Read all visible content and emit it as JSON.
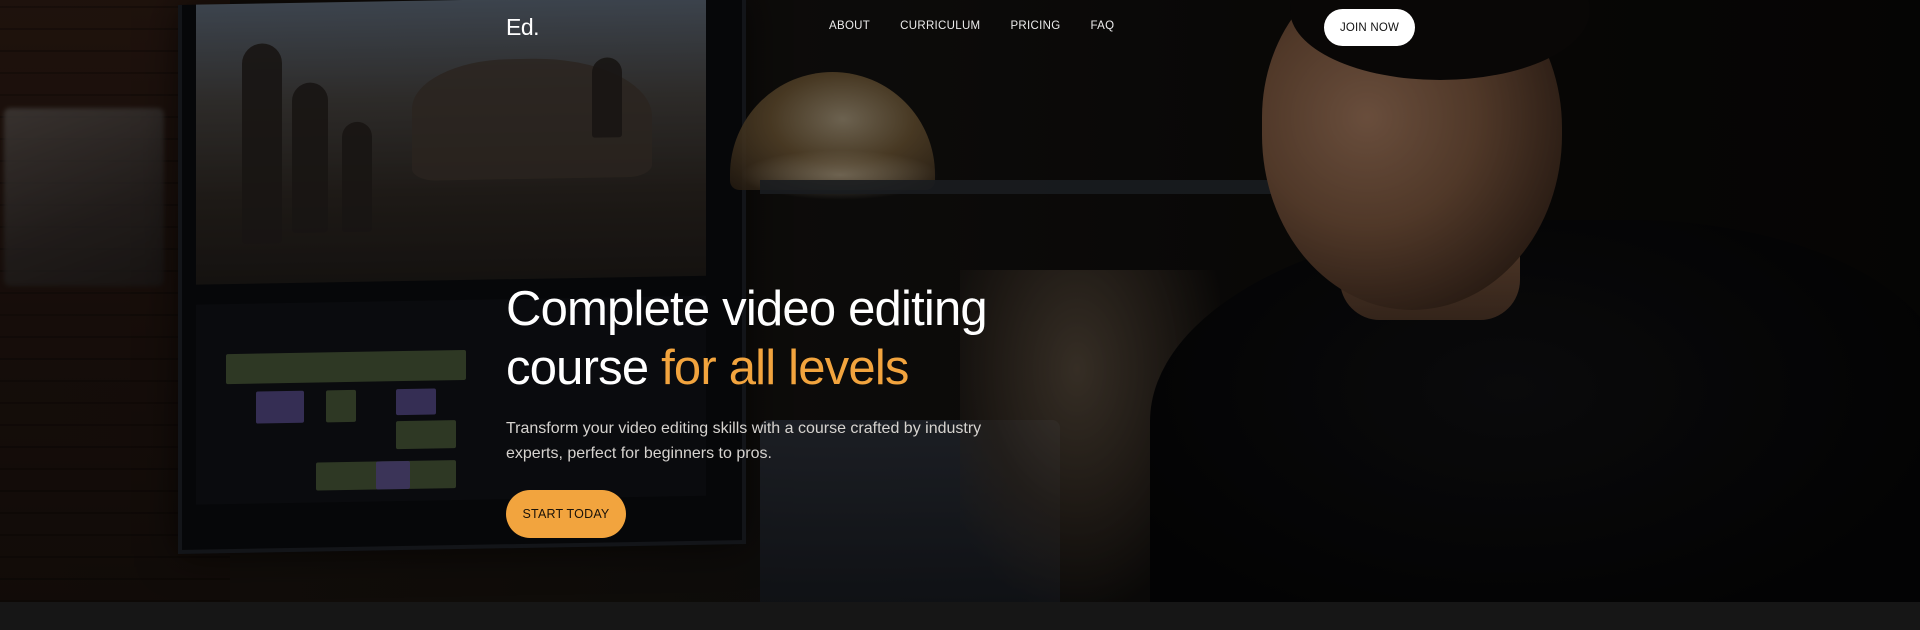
{
  "brand": {
    "logo": "Ed."
  },
  "nav": {
    "links": [
      {
        "label": "ABOUT"
      },
      {
        "label": "CURRICULUM"
      },
      {
        "label": "PRICING"
      },
      {
        "label": "FAQ"
      }
    ],
    "cta_label": "JOIN NOW"
  },
  "hero": {
    "headline_line1": "Complete video editing",
    "headline_line2_plain": "course ",
    "headline_line2_accent": "for all levels",
    "subtext": "Transform your video editing skills with a course crafted by industry experts, perfect for beginners to pros.",
    "cta_label": "START TODAY",
    "background_image": "person-editing-video-photo"
  },
  "colors": {
    "accent": "#f2a43e",
    "text": "#ffffff",
    "subtext": "#d6d3cf",
    "footer": "#161616",
    "button_light": "#ffffff"
  }
}
